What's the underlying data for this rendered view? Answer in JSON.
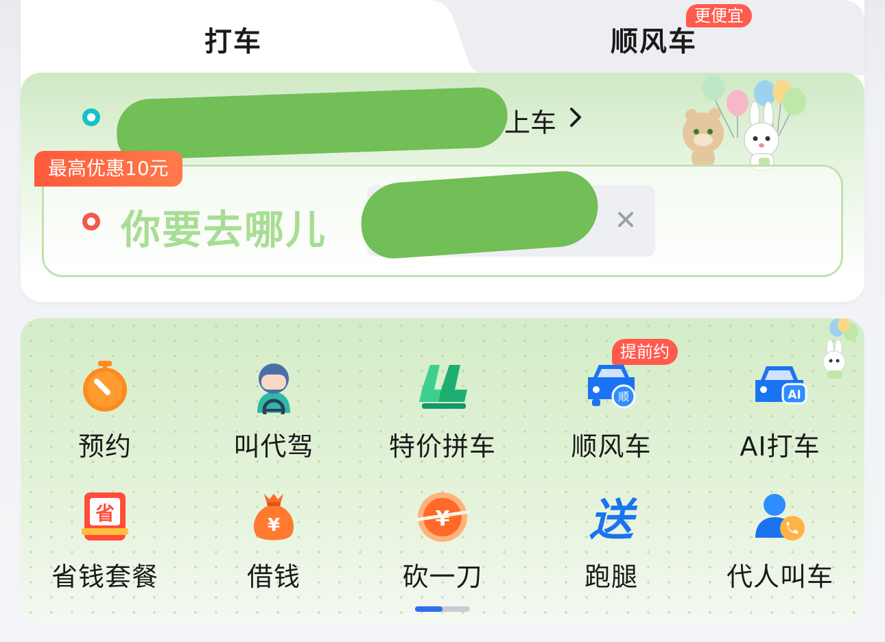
{
  "tabs": [
    {
      "label": "打车",
      "active": true
    },
    {
      "label": "顺风车",
      "active": false,
      "badge": "更便宜"
    }
  ],
  "route": {
    "pickup_suffix": "上车",
    "promo_badge": "最高优惠10元",
    "destination_placeholder": "你要去哪儿"
  },
  "services": [
    {
      "label": "预约",
      "icon": "stopwatch-icon"
    },
    {
      "label": "叫代驾",
      "icon": "designated-driver-icon"
    },
    {
      "label": "特价拼车",
      "icon": "carpool-seats-icon"
    },
    {
      "label": "顺风车",
      "icon": "hitchhike-car-icon",
      "badge": "提前约"
    },
    {
      "label": "AI打车",
      "icon": "ai-car-icon"
    },
    {
      "label": "省钱套餐",
      "icon": "savings-pack-icon"
    },
    {
      "label": "借钱",
      "icon": "money-bag-icon"
    },
    {
      "label": "砍一刀",
      "icon": "discount-coin-icon"
    },
    {
      "label": "跑腿",
      "icon": "delivery-icon"
    },
    {
      "label": "代人叫车",
      "icon": "call-for-others-icon"
    }
  ],
  "pager": {
    "current_page": 1,
    "total_pages": 2
  },
  "colors": {
    "accent_green": "#a8dd95",
    "pickup_dot": "#16c2c9",
    "dest_dot": "#f25a4e",
    "badge_red": "#ff5a4e",
    "brand_blue": "#2f6fed"
  }
}
